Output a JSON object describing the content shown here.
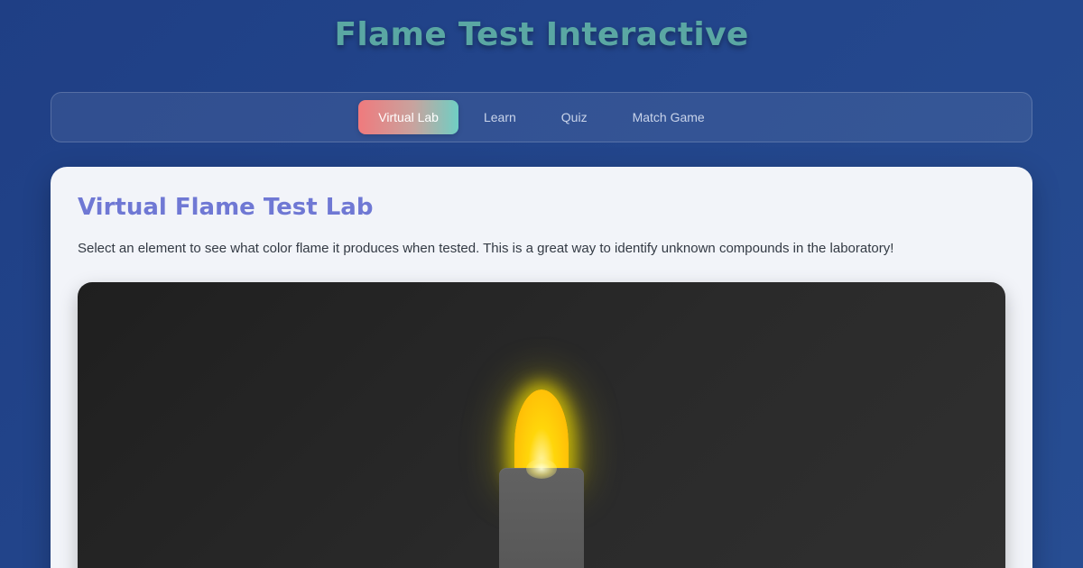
{
  "app": {
    "title": "Flame Test Interactive"
  },
  "nav": {
    "tabs": [
      {
        "label": "Virtual Lab",
        "active": true
      },
      {
        "label": "Learn",
        "active": false
      },
      {
        "label": "Quiz",
        "active": false
      },
      {
        "label": "Match Game",
        "active": false
      }
    ]
  },
  "lab": {
    "title": "Virtual Flame Test Lab",
    "description": "Select an element to see what color flame it produces when tested. This is a great way to identify unknown compounds in the laboratory!",
    "flame_color": "#ffc107"
  },
  "colors": {
    "title": "#5aa7a3",
    "section_title": "#6f78d4",
    "background": "#23468c",
    "card": "#f2f4f9",
    "stage": "#2a2a2a"
  }
}
